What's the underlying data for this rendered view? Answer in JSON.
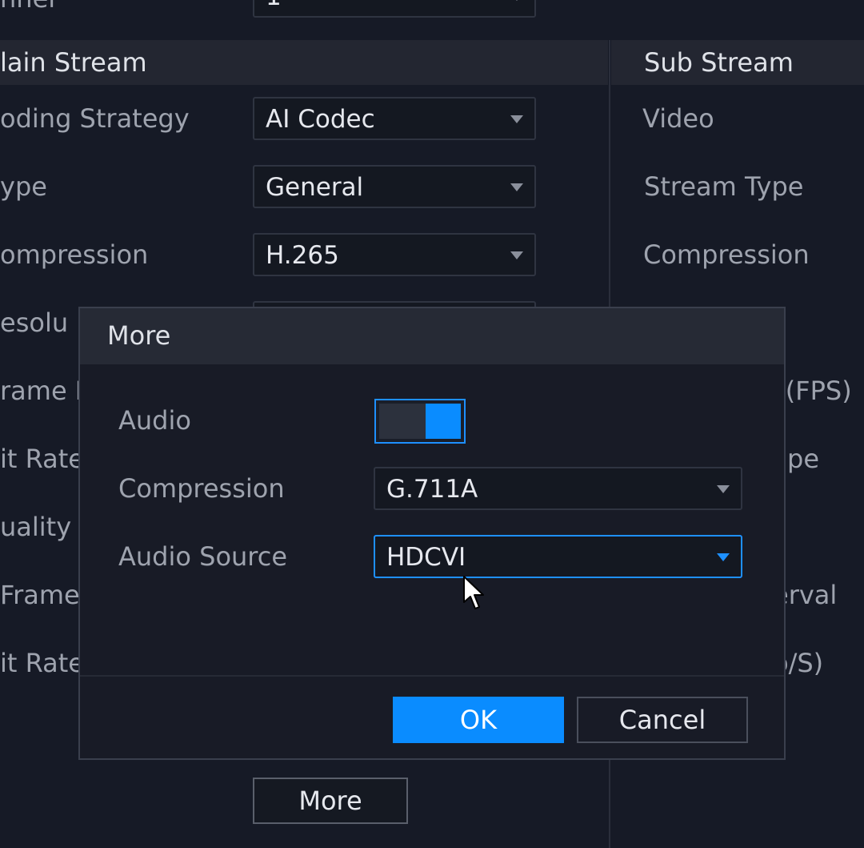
{
  "background": {
    "channel_label": "nnel",
    "channel_value": "1",
    "main_stream": {
      "header": "lain Stream",
      "rows": [
        {
          "label": "oding Strategy",
          "value": "AI Codec"
        },
        {
          "label": "ype",
          "value": "General"
        },
        {
          "label": "ompression",
          "value": "H.265"
        },
        {
          "label": "esolu"
        },
        {
          "label": "rame I"
        },
        {
          "label": "it Rate"
        },
        {
          "label": "uality"
        },
        {
          "label": "Frame"
        },
        {
          "label": "it Rate"
        }
      ]
    },
    "sub_stream": {
      "header": "Sub Stream",
      "rows": [
        {
          "label": "Video"
        },
        {
          "label": "Stream Type"
        },
        {
          "label": "Compression"
        },
        {
          "label": "e(FPS)"
        },
        {
          "label": "pe"
        },
        {
          "label": "erval"
        },
        {
          "label": "o/S)"
        }
      ]
    },
    "more_button": "More"
  },
  "dialog": {
    "title": "More",
    "audio_label": "Audio",
    "audio_enabled": true,
    "compression_label": "Compression",
    "compression_value": "G.711A",
    "audio_source_label": "Audio Source",
    "audio_source_value": "HDCVI",
    "ok_label": "OK",
    "cancel_label": "Cancel"
  },
  "colors": {
    "accent": "#0a8cff",
    "background": "#161a26",
    "panel": "#232631"
  }
}
